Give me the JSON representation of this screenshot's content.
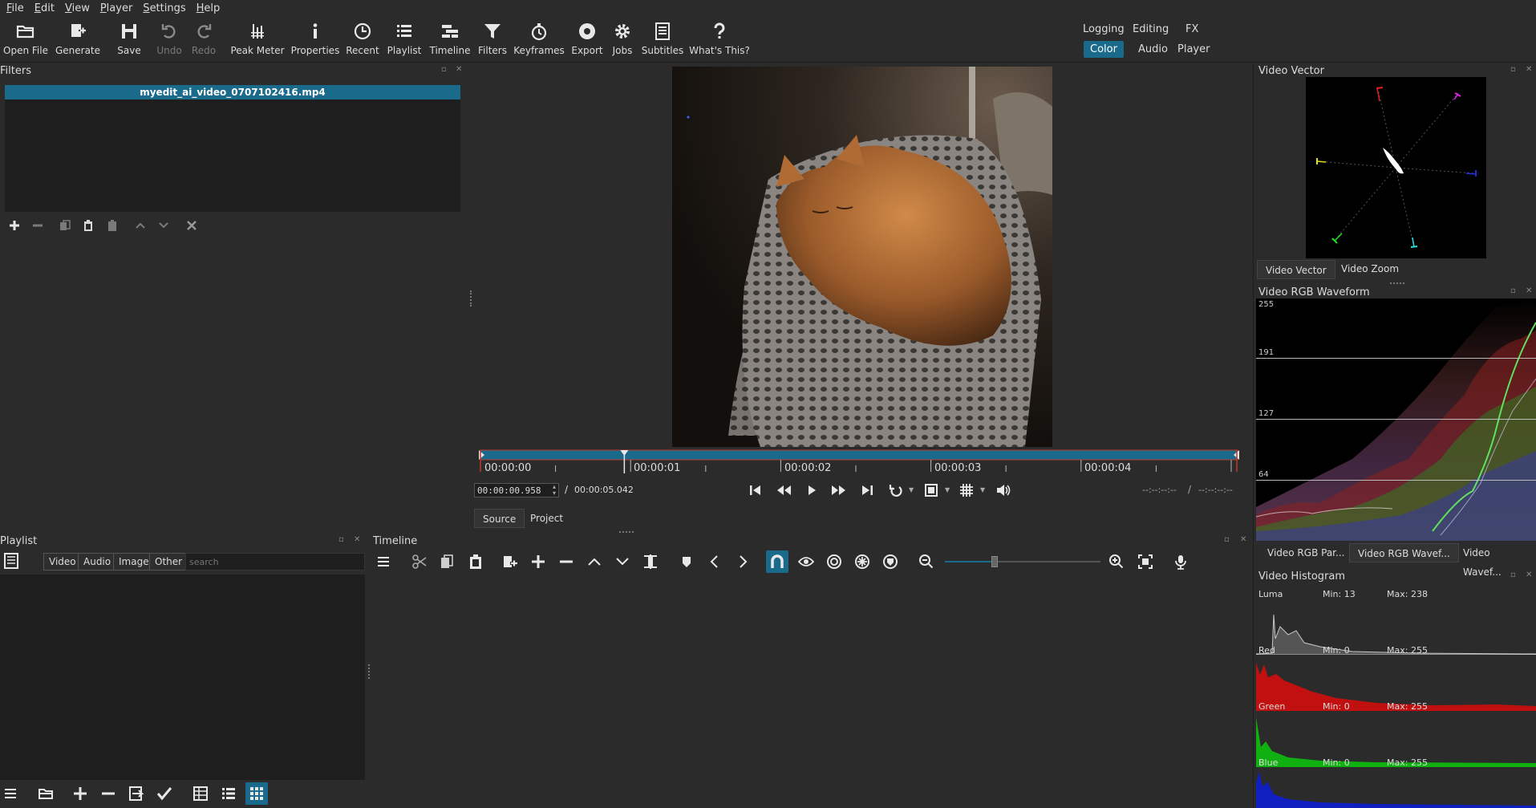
{
  "menu": [
    "File",
    "Edit",
    "View",
    "Player",
    "Settings",
    "Help"
  ],
  "toolbar": {
    "buttons": [
      {
        "label": "Open File",
        "icon": "folder-open-icon"
      },
      {
        "label": "Generate",
        "icon": "generate-icon"
      },
      {
        "label": "Save",
        "icon": "save-icon"
      },
      {
        "label": "Undo",
        "icon": "undo-icon"
      },
      {
        "label": "Redo",
        "icon": "redo-icon"
      },
      {
        "label": "Peak Meter",
        "icon": "peak-meter-icon"
      },
      {
        "label": "Properties",
        "icon": "info-icon"
      },
      {
        "label": "Recent",
        "icon": "clock-icon"
      },
      {
        "label": "Playlist",
        "icon": "list-icon"
      },
      {
        "label": "Timeline",
        "icon": "timeline-icon"
      },
      {
        "label": "Filters",
        "icon": "filter-icon"
      },
      {
        "label": "Keyframes",
        "icon": "stopwatch-icon"
      },
      {
        "label": "Export",
        "icon": "export-icon"
      },
      {
        "label": "Jobs",
        "icon": "gear-icon"
      },
      {
        "label": "Subtitles",
        "icon": "subtitles-icon"
      },
      {
        "label": "What's This?",
        "icon": "question-icon"
      }
    ],
    "layouts": {
      "logging": "Logging",
      "editing": "Editing",
      "fx": "FX",
      "color": "Color",
      "audio": "Audio",
      "player": "Player"
    }
  },
  "filters": {
    "title": "Filters",
    "clip_name": "myedit_ai_video_0707102416.mp4"
  },
  "player": {
    "ruler_labels": [
      "00:00:00",
      "00:00:01",
      "00:00:02",
      "00:00:03",
      "00:00:04"
    ],
    "current_time": "00:00:00.958",
    "separator": "/",
    "duration": "00:00:05.042",
    "in_point": "--:--:--:--",
    "out_point": "--:--:--:--",
    "tabs": {
      "source": "Source",
      "project": "Project"
    },
    "playhead_fraction": 0.19
  },
  "playlist": {
    "title": "Playlist",
    "filters": [
      "Video",
      "Audio",
      "Image",
      "Other"
    ],
    "search_placeholder": "search"
  },
  "timeline": {
    "title": "Timeline",
    "zoom_fraction": 0.32
  },
  "scopes": {
    "vector_title": "Video Vector",
    "vector_tabs": [
      "Video Vector",
      "Video Zoom"
    ],
    "waveform_title": "Video RGB Waveform",
    "waveform_levels": [
      "255",
      "191",
      "127",
      "64"
    ],
    "waveform_tabs": [
      "Video RGB Par...",
      "Video RGB Wavef...",
      "Video Wavef..."
    ],
    "histogram_title": "Video Histogram",
    "histograms": [
      {
        "name": "Luma",
        "min": "Min: 13",
        "max": "Max: 238",
        "color": "#c8c8c8"
      },
      {
        "name": "Red",
        "min": "Min: 0",
        "max": "Max: 255",
        "color": "#d01010"
      },
      {
        "name": "Green",
        "min": "Min: 0",
        "max": "Max: 255",
        "color": "#10c010"
      },
      {
        "name": "Blue",
        "min": "Min: 0",
        "max": "Max: 255",
        "color": "#1020d0"
      }
    ]
  },
  "colors": {
    "accent": "#1a6a8c",
    "background": "#2b2b2b",
    "panel": "#1e1e1e"
  }
}
